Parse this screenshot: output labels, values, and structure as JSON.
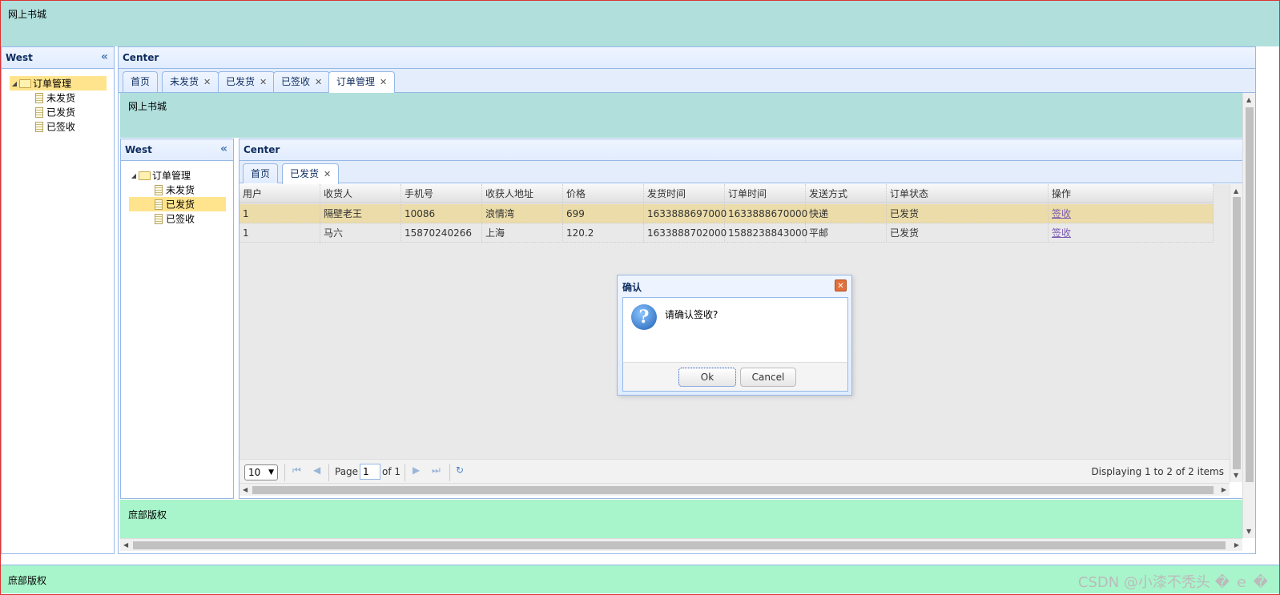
{
  "north": {
    "title": "网上书城"
  },
  "south": {
    "text": "庶部版权",
    "watermark": "CSDN @小漆不秃头 � ｅ �"
  },
  "west": {
    "title": "West",
    "tree": {
      "root": "订单管理",
      "children": [
        "未发货",
        "已发货",
        "已签收"
      ]
    }
  },
  "center": {
    "title": "Center",
    "tabs": [
      {
        "label": "首页",
        "closable": false
      },
      {
        "label": "未发货",
        "closable": true
      },
      {
        "label": "已发货",
        "closable": true
      },
      {
        "label": "已签收",
        "closable": true
      },
      {
        "label": "订单管理",
        "closable": true,
        "active": true
      }
    ],
    "inner": {
      "north_title": "网上书城",
      "south_text": "庶部版权",
      "west": {
        "title": "West",
        "tree": {
          "root": "订单管理",
          "children": [
            "未发货",
            "已发货",
            "已签收"
          ],
          "selected": "已发货"
        }
      },
      "center": {
        "title": "Center",
        "tabs": [
          {
            "label": "首页",
            "closable": false
          },
          {
            "label": "已发货",
            "closable": true,
            "active": true
          }
        ],
        "grid": {
          "columns": [
            "用户",
            "收货人",
            "手机号",
            "收获人地址",
            "价格",
            "发货时间",
            "订单时间",
            "发送方式",
            "订单状态",
            "操作"
          ],
          "rows": [
            [
              "1",
              "隔壁老王",
              "10086",
              "浪情湾",
              "699",
              "1633888697000",
              "1633888670000",
              "快递",
              "已发货",
              "签收"
            ],
            [
              "1",
              "马六",
              "15870240266",
              "上海",
              "120.2",
              "1633888702000",
              "1588238843000",
              "平邮",
              "已发货",
              "签收"
            ]
          ],
          "selected_row": 0
        },
        "pager": {
          "page_size": "10",
          "page_label": "Page",
          "page_value": "1",
          "of_label": "of 1",
          "info": "Displaying 1 to 2 of 2 items"
        }
      }
    }
  },
  "dialog": {
    "title": "确认",
    "message": "请确认签收?",
    "ok_label": "Ok",
    "cancel_label": "Cancel"
  },
  "colors": {
    "north_bg": "#b0dfdc",
    "south_bg": "#a8f5cb",
    "selected": "#ffe48d",
    "border": "#95B8E7"
  }
}
